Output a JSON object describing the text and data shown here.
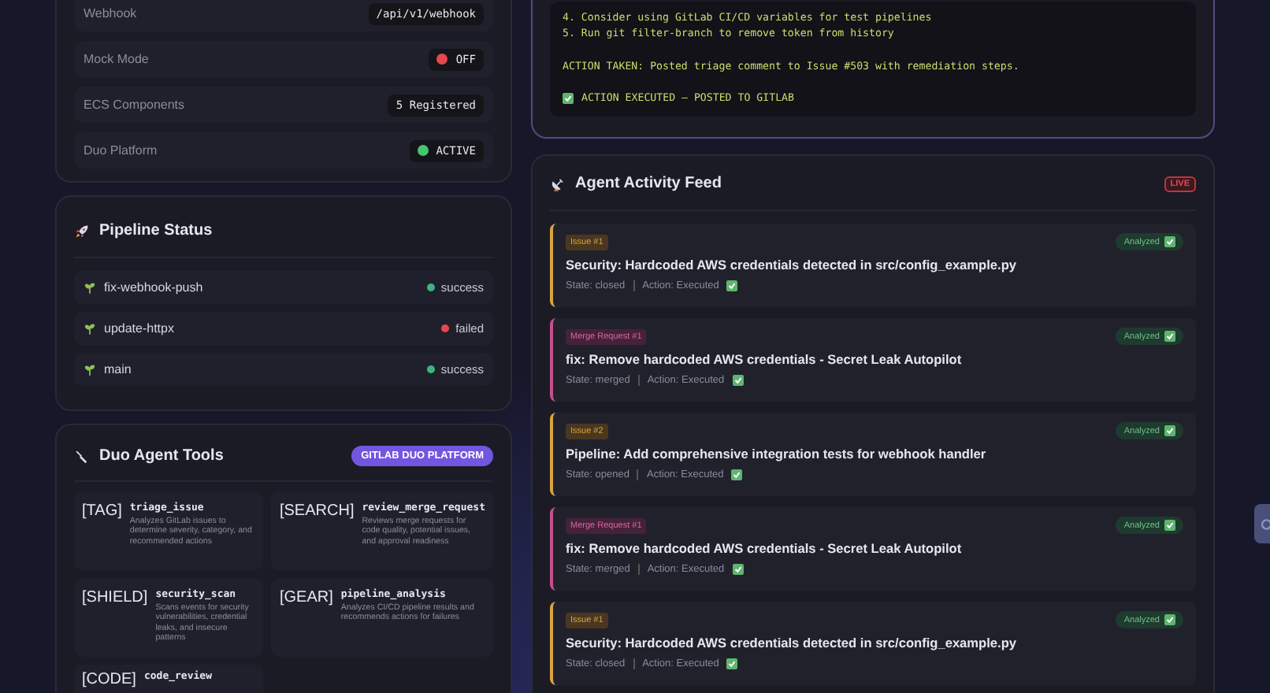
{
  "config": {
    "rows": [
      {
        "label": "Webhook",
        "value": "/api/v1/webhook"
      },
      {
        "label": "Mock Mode",
        "value": "OFF",
        "color": "#e5484d"
      },
      {
        "label": "ECS Components",
        "value": "5 Registered"
      },
      {
        "label": "Duo Platform",
        "value": "ACTIVE",
        "color": "#46c46e"
      }
    ]
  },
  "pipeline": {
    "title": "Pipeline Status",
    "rows": [
      {
        "branch": "fix-webhook-push",
        "status": "success",
        "color": "#3fb37f"
      },
      {
        "branch": "update-httpx",
        "status": "failed",
        "color": "#e5484d"
      },
      {
        "branch": "main",
        "status": "success",
        "color": "#3fb37f"
      }
    ]
  },
  "tools": {
    "title": "Duo Agent Tools",
    "badge": "GITLAB DUO PLATFORM",
    "items": [
      {
        "tag": "[TAG]",
        "name": "triage_issue",
        "description": "Analyzes GitLab issues to determine severity, category, and recommended actions"
      },
      {
        "tag": "[SEARCH]",
        "name": "review_merge_request",
        "description": "Reviews merge requests for code quality, potential issues, and approval readiness"
      },
      {
        "tag": "[SHIELD]",
        "name": "security_scan",
        "description": "Scans events for security vulnerabilities, credential leaks, and insecure patterns"
      },
      {
        "tag": "[GEAR]",
        "name": "pipeline_analysis",
        "description": "Analyzes CI/CD pipeline results and recommends actions for failures"
      },
      {
        "tag": "[CODE]",
        "name": "code_review"
      }
    ]
  },
  "terminal": {
    "lines": [
      "4. Consider using GitLab CI/CD variables for test pipelines",
      "5. Run git filter-branch to remove token from history"
    ],
    "action_taken": "ACTION TAKEN: Posted triage comment to Issue #503 with remediation steps.",
    "result": "ACTION EXECUTED — POSTED TO GITLAB"
  },
  "feed": {
    "title": "Agent Activity Feed",
    "badge": "LIVE",
    "items": [
      {
        "kind": "issue",
        "label": "Issue #1",
        "title": "Security: Hardcoded AWS credentials detected in src/config_example.py",
        "state": "State: closed",
        "action": "Action: Executed",
        "status": "Analyzed"
      },
      {
        "kind": "merge_request",
        "label": "Merge Request #1",
        "title": "fix: Remove hardcoded AWS credentials - Secret Leak Autopilot",
        "state": "State: merged",
        "action": "Action: Executed",
        "status": "Analyzed"
      },
      {
        "kind": "issue",
        "label": "Issue #2",
        "title": "Pipeline: Add comprehensive integration tests for webhook handler",
        "state": "State: opened",
        "action": "Action: Executed",
        "status": "Analyzed"
      },
      {
        "kind": "merge_request",
        "label": "Merge Request #1",
        "title": "fix: Remove hardcoded AWS credentials - Secret Leak Autopilot",
        "state": "State: merged",
        "action": "Action: Executed",
        "status": "Analyzed"
      },
      {
        "kind": "issue",
        "label": "Issue #1",
        "title": "Security: Hardcoded AWS credentials detected in src/config_example.py",
        "state": "State: closed",
        "action": "Action: Executed",
        "status": "Analyzed"
      }
    ]
  }
}
